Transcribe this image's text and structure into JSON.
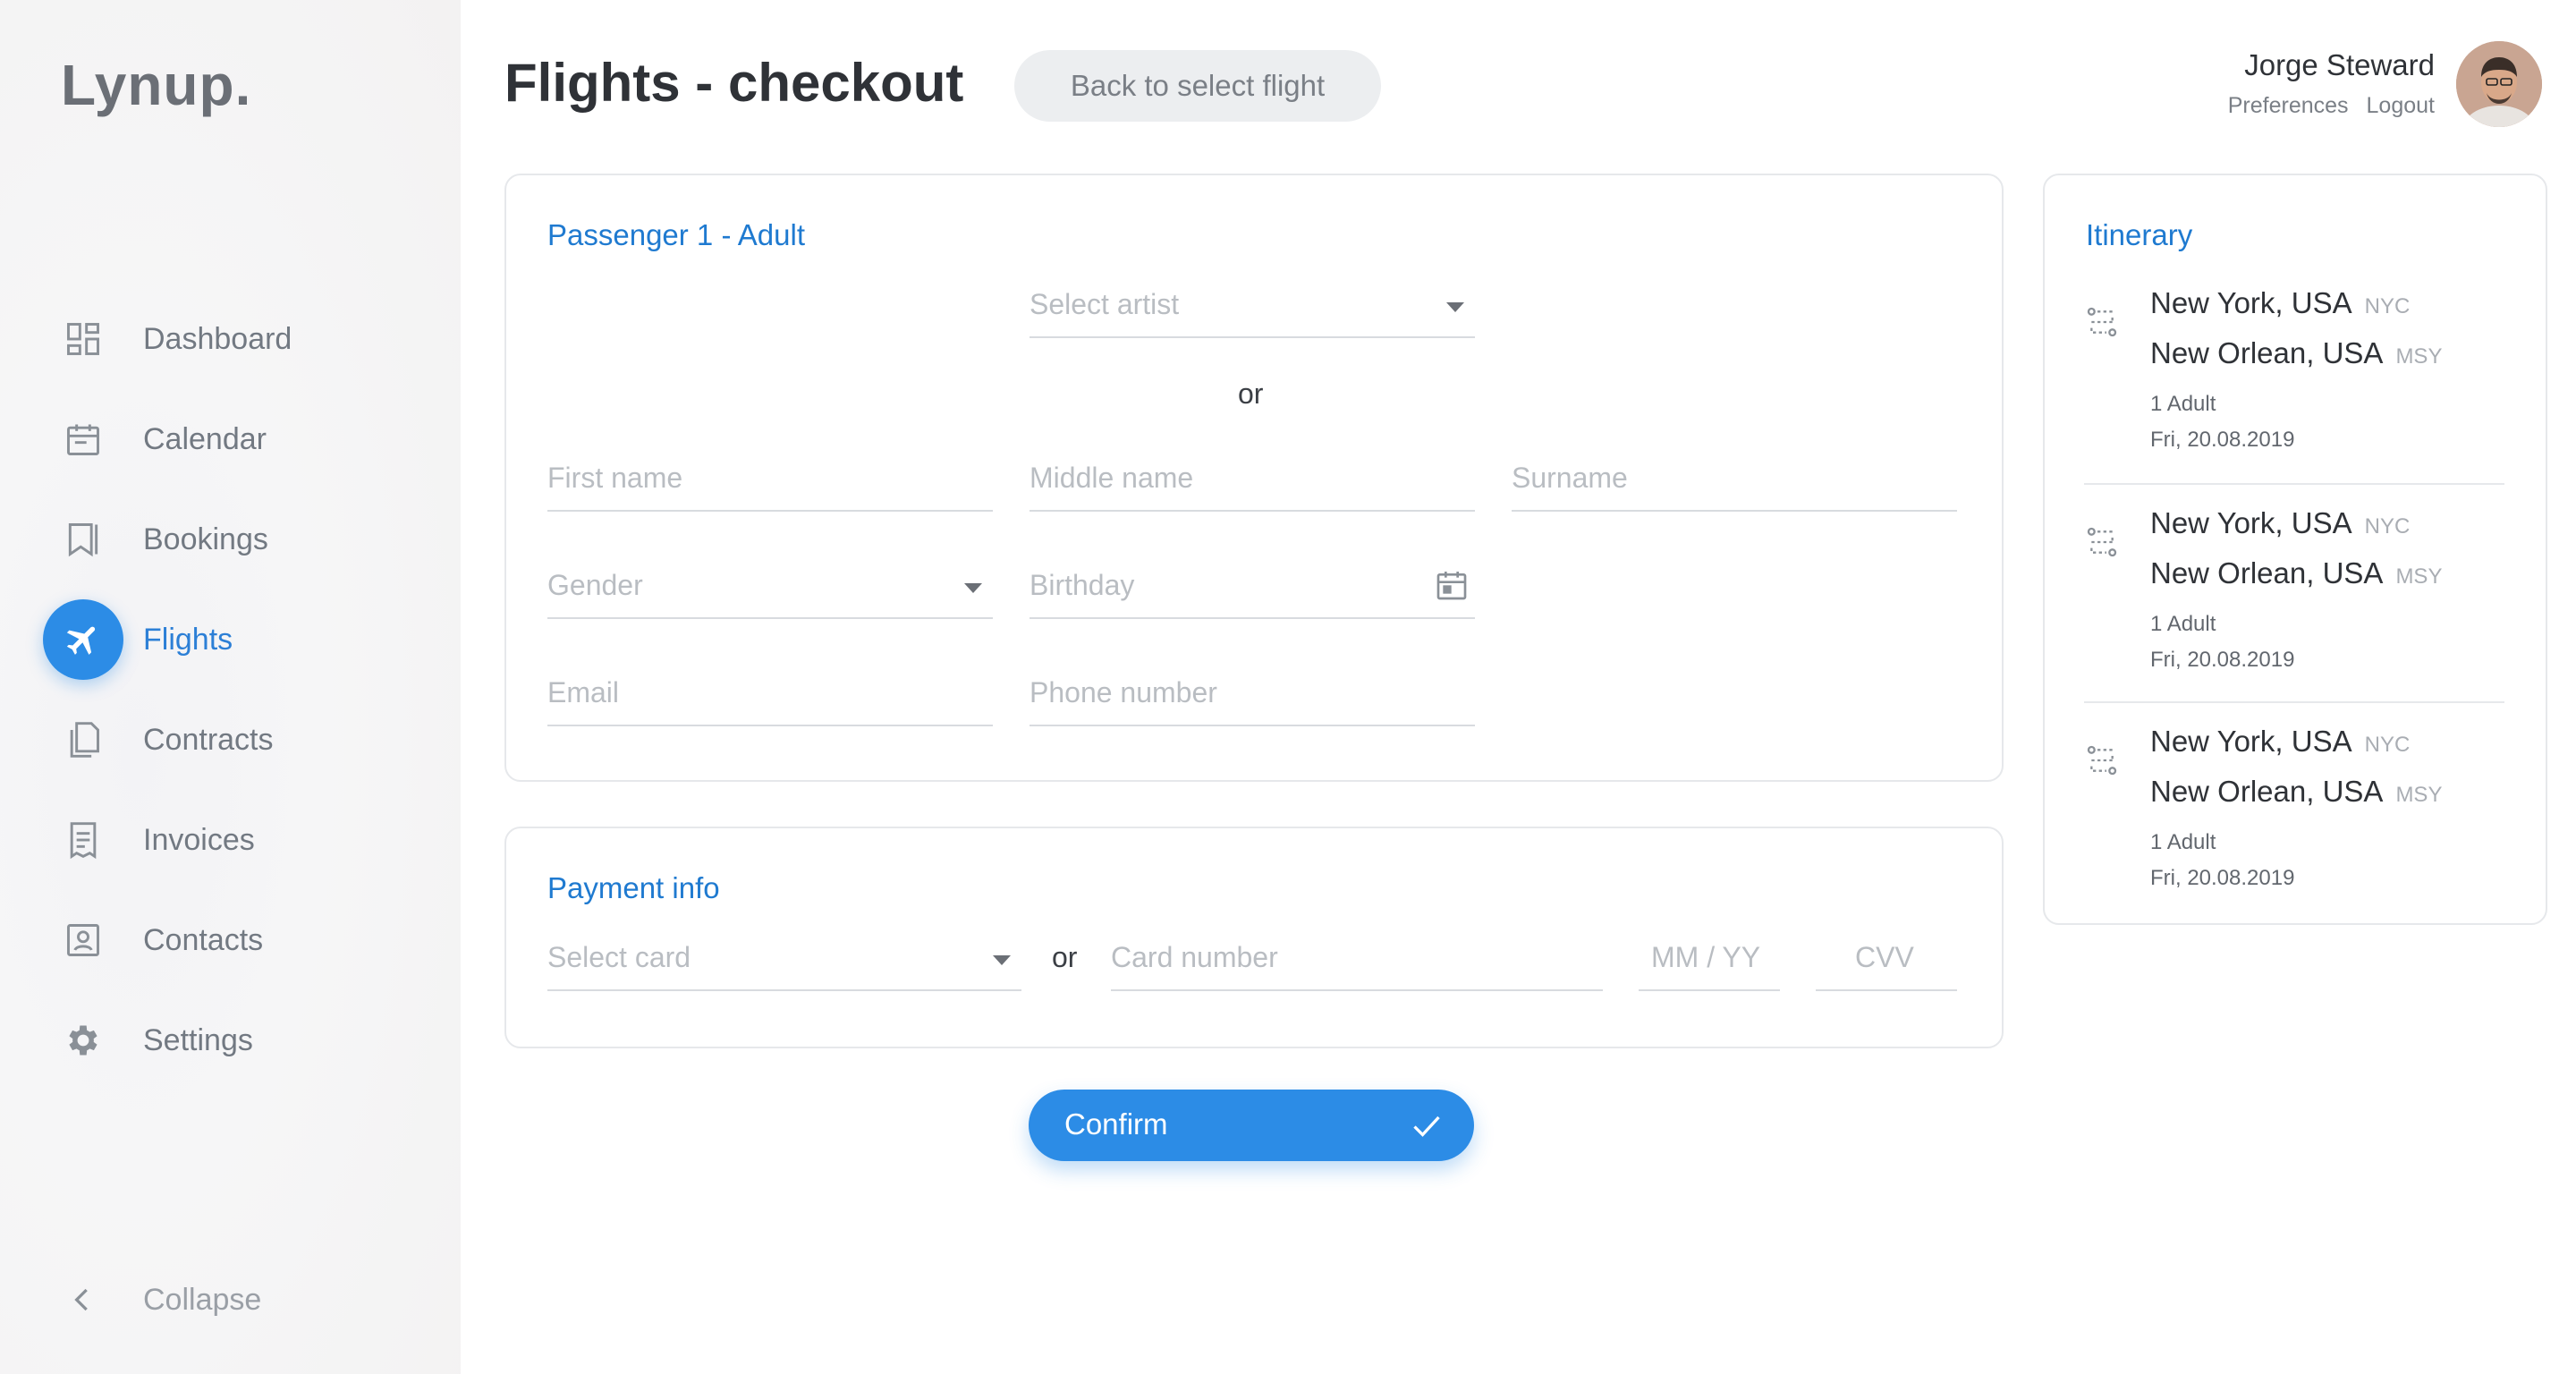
{
  "app": {
    "logo": "Lynup."
  },
  "sidebar": {
    "items": [
      {
        "label": "Dashboard",
        "icon": "dashboard-icon"
      },
      {
        "label": "Calendar",
        "icon": "calendar-icon"
      },
      {
        "label": "Bookings",
        "icon": "bookmark-icon"
      },
      {
        "label": "Flights",
        "icon": "airplane-icon",
        "active": true
      },
      {
        "label": "Contracts",
        "icon": "documents-icon"
      },
      {
        "label": "Invoices",
        "icon": "invoice-icon"
      },
      {
        "label": "Contacts",
        "icon": "contact-card-icon"
      },
      {
        "label": "Settings",
        "icon": "gear-icon"
      }
    ],
    "collapse_label": "Collapse"
  },
  "header": {
    "title": "Flights - checkout",
    "back_label": "Back to select flight",
    "user": {
      "name": "Jorge Steward",
      "preferences": "Preferences",
      "logout": "Logout"
    }
  },
  "passenger": {
    "title": "Passenger 1 - Adult",
    "select_artist": "Select artist",
    "or": "or",
    "first_name": "First name",
    "middle_name": "Middle name",
    "surname": "Surname",
    "gender": "Gender",
    "birthday": "Birthday",
    "email": "Email",
    "phone": "Phone number"
  },
  "payment": {
    "title": "Payment info",
    "select_card": "Select card",
    "or": "or",
    "card_number": "Card number",
    "expiry": "MM / YY",
    "cvv": "CVV"
  },
  "confirm_label": "Confirm",
  "itinerary": {
    "title": "Itinerary",
    "items": [
      {
        "from": "New York, USA",
        "from_code": "NYC",
        "to": "New Orlean, USA",
        "to_code": "MSY",
        "passengers": "1 Adult",
        "date": "Fri, 20.08.2019"
      },
      {
        "from": "New York, USA",
        "from_code": "NYC",
        "to": "New Orlean, USA",
        "to_code": "MSY",
        "passengers": "1 Adult",
        "date": "Fri, 20.08.2019"
      },
      {
        "from": "New York, USA",
        "from_code": "NYC",
        "to": "New Orlean, USA",
        "to_code": "MSY",
        "passengers": "1 Adult",
        "date": "Fri, 20.08.2019"
      }
    ]
  },
  "colors": {
    "accent": "#2c8ce6",
    "title_blue": "#1f7ad0",
    "text_dark": "#2f3237",
    "placeholder": "#b9bdc2"
  }
}
